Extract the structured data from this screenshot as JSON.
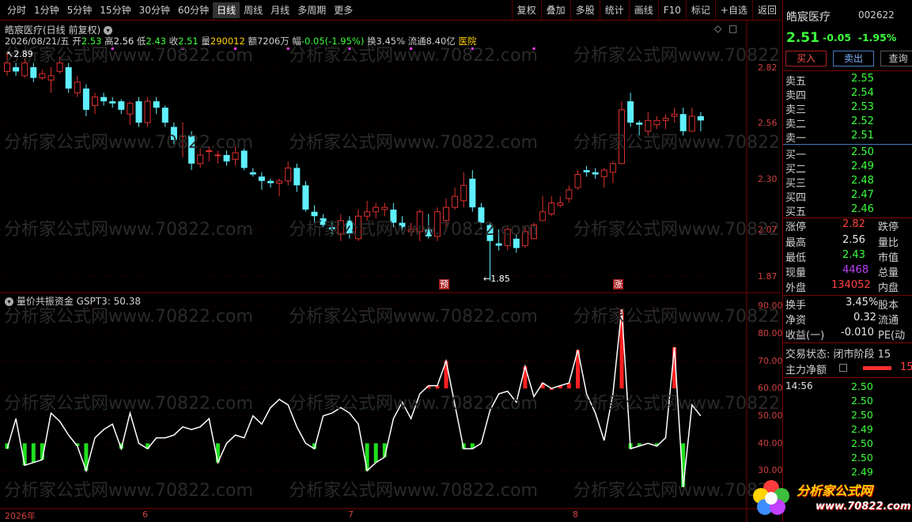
{
  "toolbar": {
    "periods": [
      "分时",
      "1分钟",
      "5分钟",
      "15分钟",
      "30分钟",
      "60分钟",
      "日线",
      "周线",
      "月线",
      "多周期",
      "更多"
    ],
    "active_period": "日线",
    "buttons": [
      "复权",
      "叠加",
      "多股",
      "统计",
      "画线",
      "F10",
      "标记",
      "+自选",
      "返回"
    ]
  },
  "chart": {
    "title": "皓宸医疗(日线 前复权)",
    "quote": {
      "date": "2026/08/21/五",
      "open_label": "开",
      "open": "2.53",
      "high_label": "高",
      "high": "2.56",
      "low_label": "低",
      "low": "2.43",
      "close_label": "收",
      "close": "2.51",
      "vol_label": "量",
      "vol": "290012",
      "amt_label": "额",
      "amt": "7206万",
      "chg_label": "幅",
      "chg": "-0.05(-1.95%)",
      "turn_label": "换",
      "turn": "3.45%",
      "float_label": "流通",
      "float": "8.40亿",
      "sector": "医院"
    },
    "high_mark": "2.89",
    "low_mark": "1.85",
    "tag_pre": "预",
    "tag_limit": "涨",
    "price_axis": [
      "2.82",
      "2.56",
      "2.30",
      "2.07",
      "1.87"
    ],
    "x_labels": [
      "2026年",
      "6",
      "7",
      "8"
    ]
  },
  "indicator": {
    "title": "量价共振资金  GSPT3: 50.38",
    "axis": [
      "90.00",
      "80.00",
      "70.00",
      "60.00",
      "50.00",
      "40.00",
      "30.00"
    ]
  },
  "chart_data": {
    "type": "candlestick",
    "x_labels": [
      "2026年",
      "6",
      "7",
      "8"
    ],
    "price_axis_ticks": [
      2.82,
      2.56,
      2.3,
      2.07,
      1.87
    ],
    "candles": [
      [
        2.8,
        2.84,
        2.89,
        2.78
      ],
      [
        2.82,
        2.8,
        2.84,
        2.78
      ],
      [
        2.78,
        2.84,
        2.86,
        2.77
      ],
      [
        2.82,
        2.77,
        2.84,
        2.75
      ],
      [
        2.77,
        2.79,
        2.81,
        2.76
      ],
      [
        2.76,
        2.78,
        2.82,
        2.7
      ],
      [
        2.8,
        2.84,
        2.87,
        2.79
      ],
      [
        2.82,
        2.72,
        2.84,
        2.7
      ],
      [
        2.7,
        2.75,
        2.78,
        2.68
      ],
      [
        2.72,
        2.62,
        2.74,
        2.59
      ],
      [
        2.64,
        2.68,
        2.7,
        2.6
      ],
      [
        2.68,
        2.66,
        2.7,
        2.64
      ],
      [
        2.66,
        2.65,
        2.68,
        2.63
      ],
      [
        2.66,
        2.62,
        2.67,
        2.6
      ],
      [
        2.6,
        2.65,
        2.66,
        2.55
      ],
      [
        2.66,
        2.56,
        2.68,
        2.54
      ],
      [
        2.56,
        2.66,
        2.68,
        2.54
      ],
      [
        2.66,
        2.63,
        2.68,
        2.6
      ],
      [
        2.63,
        2.56,
        2.64,
        2.54
      ],
      [
        2.54,
        2.48,
        2.56,
        2.46
      ],
      [
        2.5,
        2.5,
        2.56,
        2.4
      ],
      [
        2.5,
        2.37,
        2.52,
        2.34
      ],
      [
        2.37,
        2.41,
        2.44,
        2.35
      ],
      [
        2.43,
        2.43,
        2.45,
        2.38
      ],
      [
        2.41,
        2.41,
        2.43,
        2.37
      ],
      [
        2.41,
        2.38,
        2.43,
        2.36
      ],
      [
        2.39,
        2.42,
        2.45,
        2.36
      ],
      [
        2.43,
        2.35,
        2.44,
        2.34
      ],
      [
        2.33,
        2.32,
        2.35,
        2.31
      ],
      [
        2.31,
        2.29,
        2.33,
        2.25
      ],
      [
        2.29,
        2.28,
        2.3,
        2.26
      ],
      [
        2.28,
        2.29,
        2.3,
        2.22
      ],
      [
        2.29,
        2.35,
        2.38,
        2.27
      ],
      [
        2.35,
        2.27,
        2.37,
        2.24
      ],
      [
        2.27,
        2.16,
        2.29,
        2.15
      ],
      [
        2.15,
        2.13,
        2.18,
        2.1
      ],
      [
        2.12,
        2.09,
        2.14,
        2.08
      ],
      [
        2.08,
        2.07,
        2.1,
        2.05
      ],
      [
        2.05,
        2.11,
        2.14,
        2.02
      ],
      [
        2.11,
        2.05,
        2.13,
        2.03
      ],
      [
        2.03,
        2.13,
        2.16,
        2.02
      ],
      [
        2.13,
        2.15,
        2.2,
        2.11
      ],
      [
        2.15,
        2.17,
        2.19,
        2.12
      ],
      [
        2.16,
        2.17,
        2.19,
        2.13
      ],
      [
        2.16,
        2.1,
        2.19,
        2.08
      ],
      [
        2.1,
        2.08,
        2.13,
        2.06
      ],
      [
        2.06,
        2.07,
        2.1,
        2.04
      ],
      [
        2.06,
        2.15,
        2.16,
        2.02
      ],
      [
        2.07,
        2.04,
        2.14,
        2.03
      ],
      [
        2.04,
        2.15,
        2.17,
        2.02
      ],
      [
        2.11,
        2.17,
        2.21,
        2.08
      ],
      [
        2.17,
        2.22,
        2.26,
        2.16
      ],
      [
        2.2,
        2.27,
        2.33,
        2.17
      ],
      [
        2.3,
        2.17,
        2.34,
        2.15
      ],
      [
        2.17,
        2.1,
        2.19,
        2.07
      ],
      [
        2.09,
        2.02,
        2.1,
        1.85
      ],
      [
        2.01,
        2.0,
        2.07,
        1.98
      ],
      [
        2.0,
        2.07,
        2.08,
        1.98
      ],
      [
        2.03,
        1.99,
        2.05,
        1.97
      ],
      [
        2.0,
        2.06,
        2.08,
        1.99
      ],
      [
        2.03,
        2.09,
        2.1,
        2.03
      ],
      [
        2.11,
        2.15,
        2.22,
        2.12
      ],
      [
        2.14,
        2.19,
        2.22,
        2.13
      ],
      [
        2.18,
        2.19,
        2.22,
        2.17
      ],
      [
        2.21,
        2.25,
        2.27,
        2.19
      ],
      [
        2.26,
        2.32,
        2.34,
        2.25
      ],
      [
        2.34,
        2.33,
        2.36,
        2.31
      ],
      [
        2.33,
        2.32,
        2.35,
        2.3
      ],
      [
        2.31,
        2.34,
        2.35,
        2.26
      ],
      [
        2.33,
        2.37,
        2.38,
        2.28
      ],
      [
        2.37,
        2.62,
        2.66,
        2.37
      ],
      [
        2.66,
        2.56,
        2.7,
        2.54
      ],
      [
        2.56,
        2.55,
        2.57,
        2.5
      ],
      [
        2.52,
        2.57,
        2.61,
        2.5
      ],
      [
        2.55,
        2.57,
        2.59,
        2.53
      ],
      [
        2.57,
        2.58,
        2.6,
        2.53
      ],
      [
        2.59,
        2.6,
        2.63,
        2.56
      ],
      [
        2.6,
        2.52,
        2.63,
        2.5
      ],
      [
        2.52,
        2.59,
        2.63,
        2.52
      ],
      [
        2.59,
        2.57,
        2.61,
        2.52
      ]
    ],
    "indicator": {
      "name": "GSPT3",
      "last": 50.38,
      "ylim": [
        25,
        95
      ],
      "values": [
        38,
        49,
        32,
        33,
        34,
        51,
        48,
        43,
        39,
        30,
        42,
        45,
        47,
        38,
        51,
        40,
        38,
        42,
        42,
        43,
        46,
        45,
        46,
        49,
        33,
        40,
        43,
        42,
        50,
        47,
        53,
        56,
        54,
        46,
        40,
        38,
        50,
        51,
        53,
        51,
        47,
        30,
        33,
        35,
        49,
        55,
        49,
        58,
        61,
        61,
        70,
        54,
        38,
        38,
        40,
        52,
        58,
        59,
        55,
        68,
        57,
        62,
        60,
        61,
        62,
        74,
        58,
        51,
        41,
        58,
        89,
        38,
        39,
        40,
        39,
        42,
        75,
        24,
        54,
        50
      ]
    }
  },
  "rpanel": {
    "name": "皓宸医疗",
    "code": "002622",
    "price": "2.51",
    "change": "-0.05",
    "change_pct": "-1.95%",
    "buy": "买入",
    "sell": "卖出",
    "query": "查询",
    "asks": [
      {
        "label": "卖五",
        "price": "2.55"
      },
      {
        "label": "卖四",
        "price": "2.54"
      },
      {
        "label": "卖三",
        "price": "2.53"
      },
      {
        "label": "卖二",
        "price": "2.52"
      },
      {
        "label": "卖一",
        "price": "2.51"
      }
    ],
    "bids": [
      {
        "label": "买一",
        "price": "2.50"
      },
      {
        "label": "买二",
        "price": "2.49"
      },
      {
        "label": "买三",
        "price": "2.48"
      },
      {
        "label": "买四",
        "price": "2.47"
      },
      {
        "label": "买五",
        "price": "2.46"
      }
    ],
    "stats": {
      "limit_up_label": "涨停",
      "limit_up": "2.82",
      "limit_down_label": "跌停",
      "high_label": "最高",
      "high": "2.56",
      "ratio_label": "量比",
      "low_label": "最低",
      "low": "2.43",
      "mcap_label": "市值",
      "cur_vol_label": "现量",
      "cur_vol": "4468",
      "total_vol_label": "总量",
      "outer_label": "外盘",
      "outer": "134052",
      "inner_label": "内盘"
    },
    "fin": {
      "turn_label": "换手",
      "turn": "3.45%",
      "shares_label": "股本",
      "nav_label": "净资",
      "nav": "0.32",
      "float_label": "流通",
      "eps_label": "收益(一)",
      "eps": "-0.010",
      "pe_label": "PE(动"
    },
    "trade_state": "交易状态: 闭市阶段 15",
    "main_net_label": "主力净额",
    "main_net_val": "15",
    "ticks_time": "14:56",
    "ticks": [
      "2.50",
      "2.50",
      "2.50",
      "2.49",
      "2.50",
      "2.50",
      "2.49"
    ]
  },
  "logo": {
    "text": "分析家公式网",
    "url": "www.70822.com"
  },
  "colors": {
    "up": "#e03030",
    "down": "#5ff0ff",
    "green": "#3cff3c",
    "grid": "#7a0000"
  }
}
